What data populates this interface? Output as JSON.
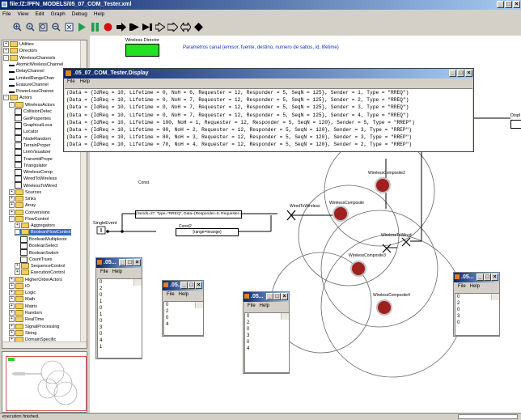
{
  "window": {
    "title": "file:/Z:/PFN_MODELS/05_07_COM_Tester.xml"
  },
  "menu": [
    "File",
    "View",
    "Edit",
    "Graph",
    "Debug",
    "Help"
  ],
  "library": [
    {
      "label": "Utilities",
      "indent": 0,
      "kind": "folder",
      "exp": "+"
    },
    {
      "label": "Directors",
      "indent": 0,
      "kind": "folder",
      "exp": "+"
    },
    {
      "label": "WirelessChannels",
      "indent": 0,
      "kind": "folder",
      "exp": "-"
    },
    {
      "label": "AtomicWirelessChannel",
      "indent": 1,
      "kind": "channel"
    },
    {
      "label": "DelayChannel",
      "indent": 1,
      "kind": "channel"
    },
    {
      "label": "LimitedRangeChan",
      "indent": 1,
      "kind": "channel"
    },
    {
      "label": "ErasureChannel",
      "indent": 1,
      "kind": "channel"
    },
    {
      "label": "PowerLossChanne",
      "indent": 1,
      "kind": "channel"
    },
    {
      "label": "Actors",
      "indent": 0,
      "kind": "folder",
      "exp": "-"
    },
    {
      "label": "WirelessActors",
      "indent": 1,
      "kind": "folder",
      "exp": "-"
    },
    {
      "label": "CollisionDetec",
      "indent": 2,
      "kind": "actor"
    },
    {
      "label": "GetProperties",
      "indent": 2,
      "kind": "actor"
    },
    {
      "label": "GraphicalLoca",
      "indent": 2,
      "kind": "actor"
    },
    {
      "label": "Locator",
      "indent": 2,
      "kind": "actor"
    },
    {
      "label": "NodeRandom",
      "indent": 2,
      "kind": "actor"
    },
    {
      "label": "TerrainProper",
      "indent": 2,
      "kind": "actor"
    },
    {
      "label": "LinkVisualizer",
      "indent": 2,
      "kind": "actor"
    },
    {
      "label": "TransmitPrope",
      "indent": 2,
      "kind": "actor"
    },
    {
      "label": "Triangulator",
      "indent": 2,
      "kind": "actor"
    },
    {
      "label": "WirelessComp",
      "indent": 2,
      "kind": "actor"
    },
    {
      "label": "WiredToWireless",
      "indent": 2,
      "kind": "actor"
    },
    {
      "label": "WirelessToWired",
      "indent": 2,
      "kind": "actor"
    },
    {
      "label": "Sources",
      "indent": 1,
      "kind": "folder",
      "exp": "+"
    },
    {
      "label": "Sinks",
      "indent": 1,
      "kind": "folder",
      "exp": "+"
    },
    {
      "label": "Array",
      "indent": 1,
      "kind": "folder",
      "exp": "+"
    },
    {
      "label": "Conversions",
      "indent": 1,
      "kind": "folder",
      "exp": "+"
    },
    {
      "label": "FlowControl",
      "indent": 1,
      "kind": "folder",
      "exp": "-"
    },
    {
      "label": "Aggregators",
      "indent": 2,
      "kind": "folder",
      "exp": "+"
    },
    {
      "label": "BooleanFlowControl",
      "indent": 2,
      "kind": "folder",
      "exp": "-",
      "selected": true
    },
    {
      "label": "BooleanMultiplexor",
      "indent": 3,
      "kind": "actor"
    },
    {
      "label": "BooleanSelect",
      "indent": 3,
      "kind": "actor"
    },
    {
      "label": "BooleanSwitch",
      "indent": 3,
      "kind": "actor"
    },
    {
      "label": "CountTrues",
      "indent": 3,
      "kind": "actor"
    },
    {
      "label": "SequenceControl",
      "indent": 2,
      "kind": "folder",
      "exp": "+"
    },
    {
      "label": "ExecutionControl",
      "indent": 2,
      "kind": "folder",
      "exp": "+"
    },
    {
      "label": "HigherOrderActors",
      "indent": 1,
      "kind": "folder",
      "exp": "+"
    },
    {
      "label": "IO",
      "indent": 1,
      "kind": "folder",
      "exp": "+"
    },
    {
      "label": "Logic",
      "indent": 1,
      "kind": "folder",
      "exp": "+"
    },
    {
      "label": "Math",
      "indent": 1,
      "kind": "folder",
      "exp": "+"
    },
    {
      "label": "Matrix",
      "indent": 1,
      "kind": "folder",
      "exp": "+"
    },
    {
      "label": "Random",
      "indent": 1,
      "kind": "folder",
      "exp": "+"
    },
    {
      "label": "RealTime",
      "indent": 1,
      "kind": "folder",
      "exp": "+"
    },
    {
      "label": "SignalProcessing",
      "indent": 1,
      "kind": "folder",
      "exp": "+"
    },
    {
      "label": "String",
      "indent": 1,
      "kind": "folder",
      "exp": "+"
    },
    {
      "label": "DomainSpecific",
      "indent": 1,
      "kind": "folder",
      "exp": "+"
    }
  ],
  "canvas": {
    "director_label": "Wireless Director",
    "params_text": "Parametros canal (emisor, fuente, destino, numero de saltos, id, lifetime)",
    "const1_label": "Const",
    "const1_value": "{Sends=27, Type=\"RREQ\", Data={Responder=5, Requester=12...",
    "const2_label": "Const2",
    "const2_value": "{range=inrange}",
    "single_event": "SingleEvent",
    "wired_to_wireless": "WiredToWireless",
    "wireless_to_wired": "WirelessToWired",
    "display_label": "Displ",
    "composites": [
      {
        "label": "WirelessComposite2"
      },
      {
        "label": "WirelessComposite"
      },
      {
        "label": "WirelessComposite3"
      },
      {
        "label": "WirelessComposite4"
      }
    ]
  },
  "display_window": {
    "title": ".05_07_COM_Tester.Display",
    "menu": [
      "File",
      "Help"
    ],
    "lines": [
      "(Data = {IdReq = 10, Lifetime = 0, NoH = 6, Requester = 12, Responder = 5, SeqN = 125}, Sender = 1, Type = \"RREQ\")",
      "(Data = {IdReq = 10, Lifetime = 0, NoH = 7, Requester = 12, Responder = 5, SeqN = 125}, Sender = 2, Type = \"RREQ\")",
      "(Data = {IdReq = 10, Lifetime = 0, NoH = 7, Requester = 12, Responder = 5, SeqN = 125}, Sender = 3, Type = \"RREQ\")",
      "(Data = {IdReq = 10, Lifetime = 0, NoH = 7, Requester = 12, Responder = 5, SeqN = 125}, Sender = 4, Type = \"RREQ\")",
      "(Data = {IdReq = 10, Lifetime = 100, NoH = 1, Requester = 12, Responder = 5, SeqN = 120}, Sender = 5, Type = \"RREP\")",
      "(Data = {IdReq = 10, Lifetime = 90, NoH = 2, Requester = 12, Responder = 5, SeqN = 120}, Sender = 3, Type = \"RREP\")",
      "(Data = {IdReq = 10, Lifetime = 80, NoH = 3, Requester = 12, Responder = 5, SeqN = 120}, Sender = 3, Type = \"RREP\")",
      "(Data = {IdReq = 10, Lifetime = 70, NoH = 4, Requester = 12, Responder = 5, SeqN = 120}, Sender = 2, Type = \"RREP\")"
    ]
  },
  "small_windows": [
    {
      "title": ".05...",
      "menu": [
        "File",
        "Help"
      ],
      "values": [
        "0",
        "2",
        "0",
        "1",
        "0",
        "1",
        "0",
        "3",
        "0",
        "4",
        "1"
      ]
    },
    {
      "title": ".05...",
      "menu": [
        "File",
        "Help"
      ],
      "values": [
        "0",
        "2",
        "0",
        "4"
      ]
    },
    {
      "title": ".05...",
      "menu": [
        "File",
        "Help"
      ],
      "values": [
        "0",
        "2",
        "0",
        "3",
        "0",
        "4"
      ]
    },
    {
      "title": ".05...",
      "menu": [
        "File",
        "Help"
      ],
      "values": [
        "0",
        "2",
        "0",
        "3",
        "0"
      ]
    }
  ],
  "status": "execution finished."
}
